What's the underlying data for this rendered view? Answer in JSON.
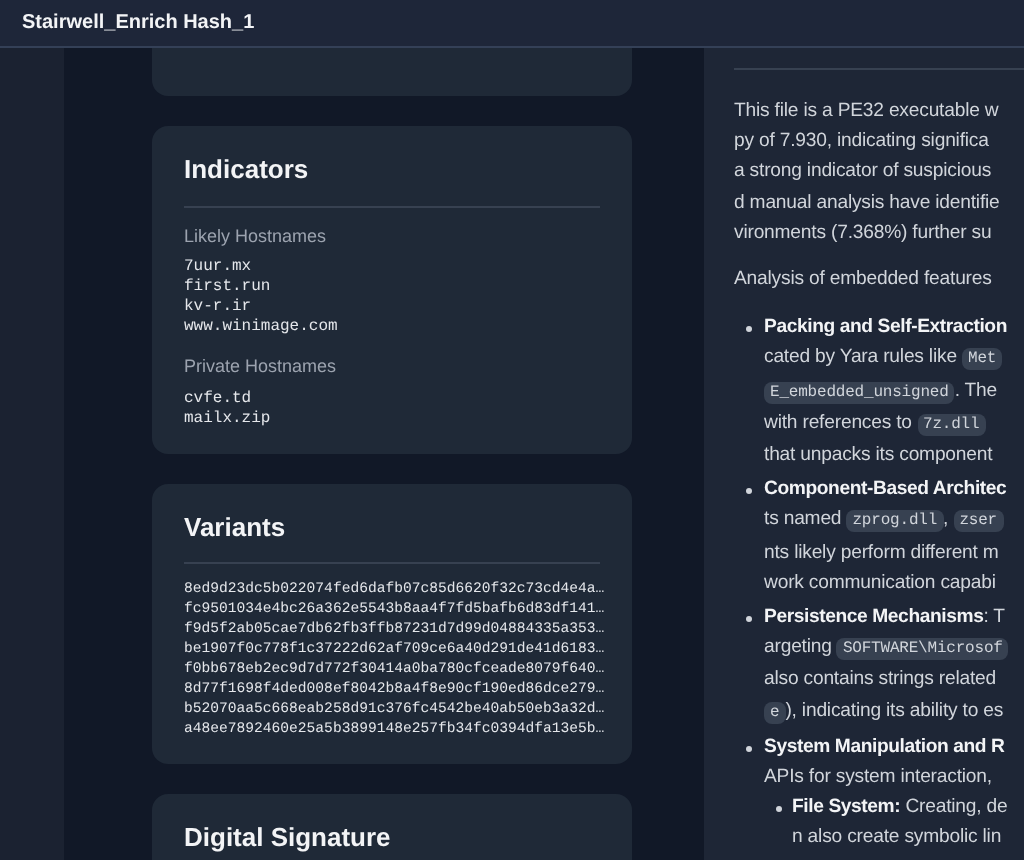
{
  "window": {
    "title": "Stairwell_Enrich Hash_1"
  },
  "indicators": {
    "title": "Indicators",
    "groups": [
      {
        "label": "Likely Hostnames",
        "items": [
          "7uur.mx",
          "first.run",
          "kv-r.ir",
          "www.winimage.com"
        ]
      },
      {
        "label": "Private Hostnames",
        "items": [
          "cvfe.td",
          "mailx.zip"
        ]
      }
    ]
  },
  "variants": {
    "title": "Variants",
    "hashes": [
      "8ed9d23dc5b022074fed6dafb07c85d6620f32c73cd4e4a…",
      "fc9501034e4bc26a362e5543b8aa4f7fd5bafb6d83df141…",
      "f9d5f2ab05cae7db62fb3ffb87231d7d99d04884335a353…",
      "be1907f0c778f1c37222d62af709ce6a40d291de41d6183…",
      "f0bb678eb2ec9d7d772f30414a0ba780cfceade8079f640…",
      "8d77f1698f4ded008ef8042b8a4f8e90cf190ed86dce279…",
      "b52070aa5c668eab258d91c376fc4542be40ab50eb3a32d…",
      "a48ee7892460e25a5b3899148e257fb34fc0394dfa13e5b…"
    ]
  },
  "signature": {
    "title": "Digital Signature"
  },
  "summary": {
    "lines": [
      {
        "kind": "para",
        "segments": [
          {
            "kind": "text",
            "text": "This file is a PE32 executable w"
          }
        ]
      },
      {
        "kind": "para",
        "segments": [
          {
            "kind": "text",
            "text": "py of 7.930, indicating significa"
          }
        ]
      },
      {
        "kind": "para",
        "segments": [
          {
            "kind": "text",
            "text": "a strong indicator of suspicious"
          }
        ]
      },
      {
        "kind": "para",
        "segments": [
          {
            "kind": "text",
            "text": "d manual analysis have identifie"
          }
        ]
      },
      {
        "kind": "para",
        "segments": [
          {
            "kind": "text",
            "text": "vironments (7.368%) further su"
          }
        ]
      },
      {
        "kind": "gap",
        "segments": [
          {
            "kind": "text",
            "text": "Analysis of embedded features"
          }
        ]
      },
      {
        "kind": "bullet",
        "segments": [
          {
            "kind": "bold",
            "text": "Packing and Self-Extraction"
          }
        ]
      },
      {
        "kind": "cont",
        "segments": [
          {
            "kind": "text",
            "text": "cated by Yara rules like "
          },
          {
            "kind": "code",
            "text": "Met"
          }
        ]
      },
      {
        "kind": "cont",
        "segments": [
          {
            "kind": "code",
            "text": "E_embedded_unsigned"
          },
          {
            "kind": "text",
            "text": ". The "
          }
        ]
      },
      {
        "kind": "cont",
        "segments": [
          {
            "kind": "text",
            "text": "with references to "
          },
          {
            "kind": "code",
            "text": "7z.dll"
          }
        ]
      },
      {
        "kind": "cont",
        "segments": [
          {
            "kind": "text",
            "text": "that unpacks its component"
          }
        ]
      },
      {
        "kind": "bullet",
        "segments": [
          {
            "kind": "bold",
            "text": "Component-Based Architec"
          }
        ]
      },
      {
        "kind": "cont",
        "segments": [
          {
            "kind": "text",
            "text": "ts named "
          },
          {
            "kind": "code",
            "text": "zprog.dll"
          },
          {
            "kind": "text",
            "text": ", "
          },
          {
            "kind": "code",
            "text": "zser"
          }
        ]
      },
      {
        "kind": "cont",
        "segments": [
          {
            "kind": "text",
            "text": "nts likely perform different m"
          }
        ]
      },
      {
        "kind": "cont",
        "segments": [
          {
            "kind": "text",
            "text": "work communication capabi"
          }
        ]
      },
      {
        "kind": "bullet",
        "segments": [
          {
            "kind": "bold",
            "text": "Persistence Mechanisms"
          },
          {
            "kind": "text",
            "text": ": T"
          }
        ]
      },
      {
        "kind": "cont",
        "segments": [
          {
            "kind": "text",
            "text": "argeting "
          },
          {
            "kind": "code",
            "text": "SOFTWARE\\Microsof"
          }
        ]
      },
      {
        "kind": "cont",
        "segments": [
          {
            "kind": "text",
            "text": "also contains strings related"
          }
        ]
      },
      {
        "kind": "cont",
        "segments": [
          {
            "kind": "code",
            "text": "e"
          },
          {
            "kind": "text",
            "text": "), indicating its ability to es"
          }
        ]
      },
      {
        "kind": "bullet",
        "segments": [
          {
            "kind": "bold",
            "text": "System Manipulation and R"
          }
        ]
      },
      {
        "kind": "cont",
        "segments": [
          {
            "kind": "text",
            "text": "APIs for system interaction,"
          }
        ]
      },
      {
        "kind": "subbullet",
        "segments": [
          {
            "kind": "bold",
            "text": "File System:"
          },
          {
            "kind": "text",
            "text": " Creating, de"
          }
        ]
      },
      {
        "kind": "subcont",
        "segments": [
          {
            "kind": "text",
            "text": "n also create symbolic lin"
          }
        ]
      }
    ]
  }
}
